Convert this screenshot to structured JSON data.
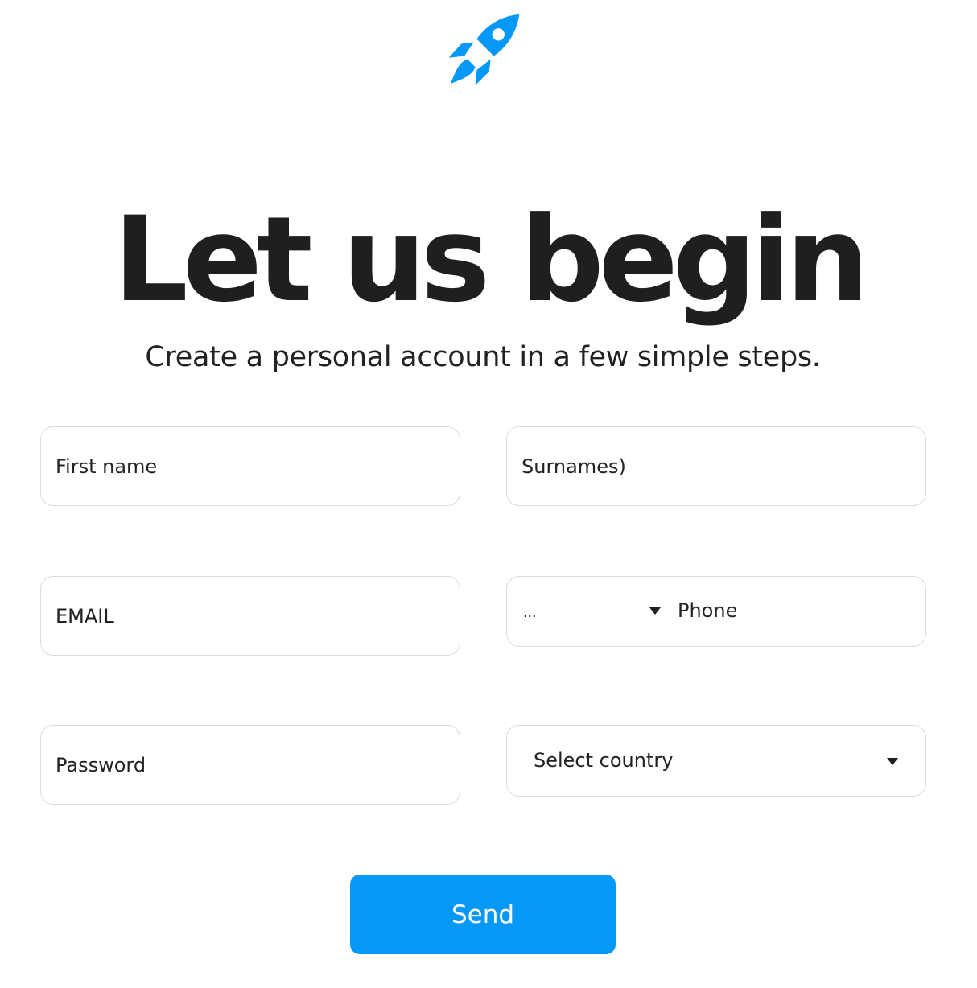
{
  "brand": {
    "icon": "rocket-icon",
    "accent_color": "#0698f7"
  },
  "hero": {
    "title": "Let us begin",
    "subtitle": "Create a personal account in a few simple steps."
  },
  "form": {
    "first_name": {
      "placeholder": "First name",
      "value": ""
    },
    "surnames": {
      "placeholder": "Surnames)",
      "value": ""
    },
    "email": {
      "placeholder": "EMAIL",
      "value": ""
    },
    "phone": {
      "dial_code_selected": "...",
      "placeholder": "Phone",
      "value": ""
    },
    "password": {
      "placeholder": "Password",
      "value": ""
    },
    "country": {
      "selected": "Select country"
    },
    "submit_label": "Send"
  }
}
